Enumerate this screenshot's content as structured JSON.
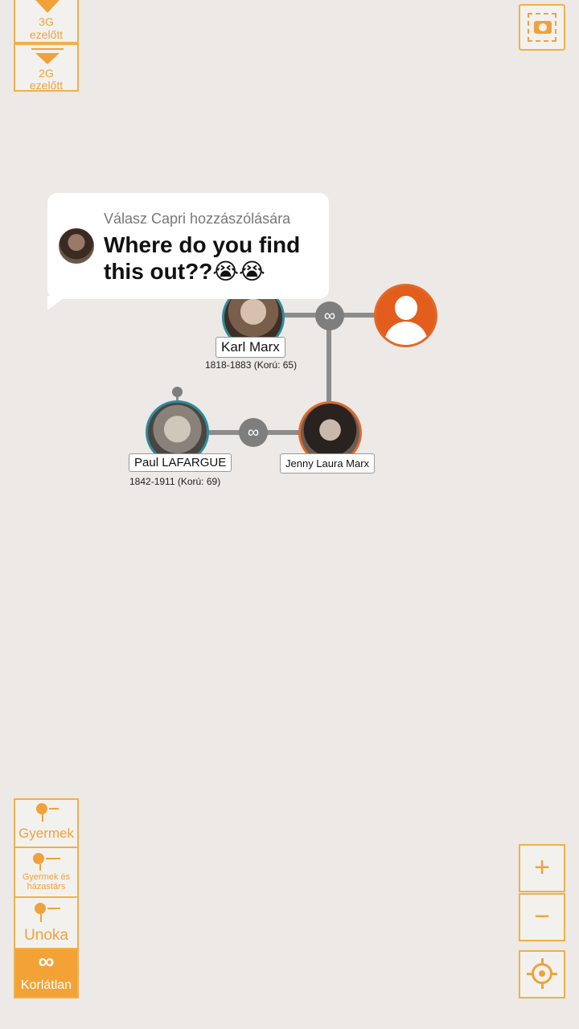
{
  "generations": {
    "btn3": {
      "label_top": "3G",
      "label_bottom": "ezelőtt"
    },
    "btn2": {
      "label_top": "2G",
      "label_bottom": "ezelőtt"
    }
  },
  "comment": {
    "reply_to": "Válasz Capri hozzászólására",
    "text": "Where do you find this out??😭😭"
  },
  "persons": {
    "karl": {
      "name": "Karl Marx",
      "years": "1818-1883 (Korú: 65)"
    },
    "paul": {
      "name": "Paul LAFARGUE",
      "years": "1842-1911 (Korú: 69)"
    },
    "jenny": {
      "name": "Jenny Laura Marx"
    }
  },
  "filters": {
    "child": "Gyermek",
    "child_spouse": "Gyermek és házastárs",
    "grandchild": "Unoka",
    "unlimited": "Korlátlan"
  },
  "zoom": {
    "in": "+",
    "out": "−"
  },
  "colors": {
    "accent": "#f0b049",
    "accent_fill": "#f3a335",
    "male_ring": "#2d8c9c",
    "female_ring": "#e06a2a"
  }
}
